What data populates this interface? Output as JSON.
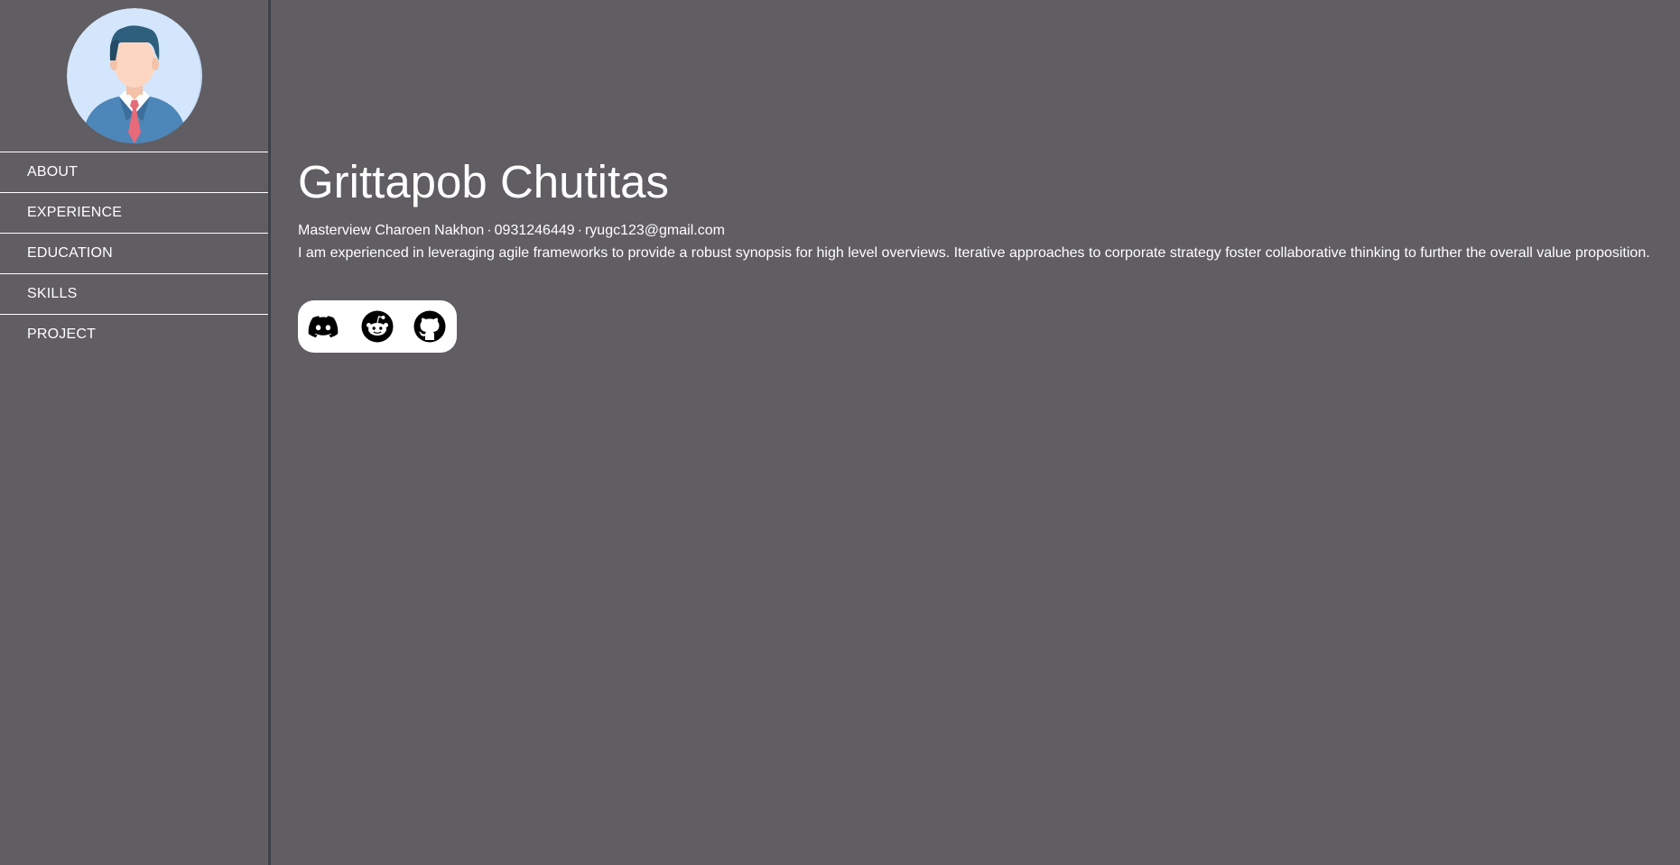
{
  "profile": {
    "name": "Grittapob Chutitas",
    "location": "Masterview Charoen Nakhon",
    "phone": "0931246449",
    "email": "ryugc123@gmail.com",
    "separator": "·",
    "bio": "I am experienced in leveraging agile frameworks to provide a robust synopsis for high level overviews. Iterative approaches to corporate strategy foster collaborative thinking to further the overall value proposition."
  },
  "sidebar": {
    "avatar_icon": "businessman-avatar",
    "items": [
      {
        "label": "ABOUT"
      },
      {
        "label": "EXPERIENCE"
      },
      {
        "label": "EDUCATION"
      },
      {
        "label": "SKILLS"
      },
      {
        "label": "PROJECT"
      }
    ]
  },
  "social": {
    "links": [
      {
        "icon": "discord-icon"
      },
      {
        "icon": "reddit-icon"
      },
      {
        "icon": "github-icon"
      }
    ]
  },
  "colors": {
    "background": "#605d63",
    "sidebar_border": "#3d4148",
    "text": "#ffffff",
    "social_bar": "#ffffff"
  }
}
